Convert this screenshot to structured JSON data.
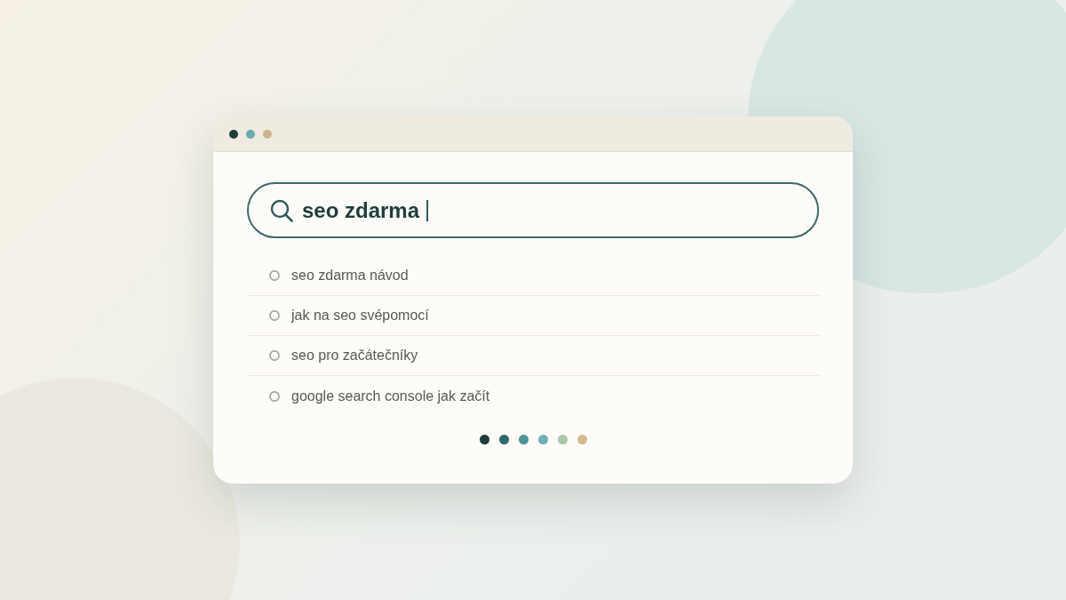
{
  "window": {
    "controls": [
      {
        "color": "#1f3d3a"
      },
      {
        "color": "#6aaab0"
      },
      {
        "color": "#c9b48e"
      }
    ]
  },
  "search": {
    "value": "seo zdarma",
    "focused": true
  },
  "suggestions": [
    {
      "text": "seo zdarma návod"
    },
    {
      "text": "jak na seo svépomocí"
    },
    {
      "text": "seo pro začátečníky"
    },
    {
      "text": "google search console jak začít"
    }
  ],
  "palette_dots": [
    {
      "color": "#1f3d3a"
    },
    {
      "color": "#2f6a6c"
    },
    {
      "color": "#4f9499"
    },
    {
      "color": "#6fb0b8"
    },
    {
      "color": "#a9c6a8"
    },
    {
      "color": "#d4b890"
    }
  ]
}
